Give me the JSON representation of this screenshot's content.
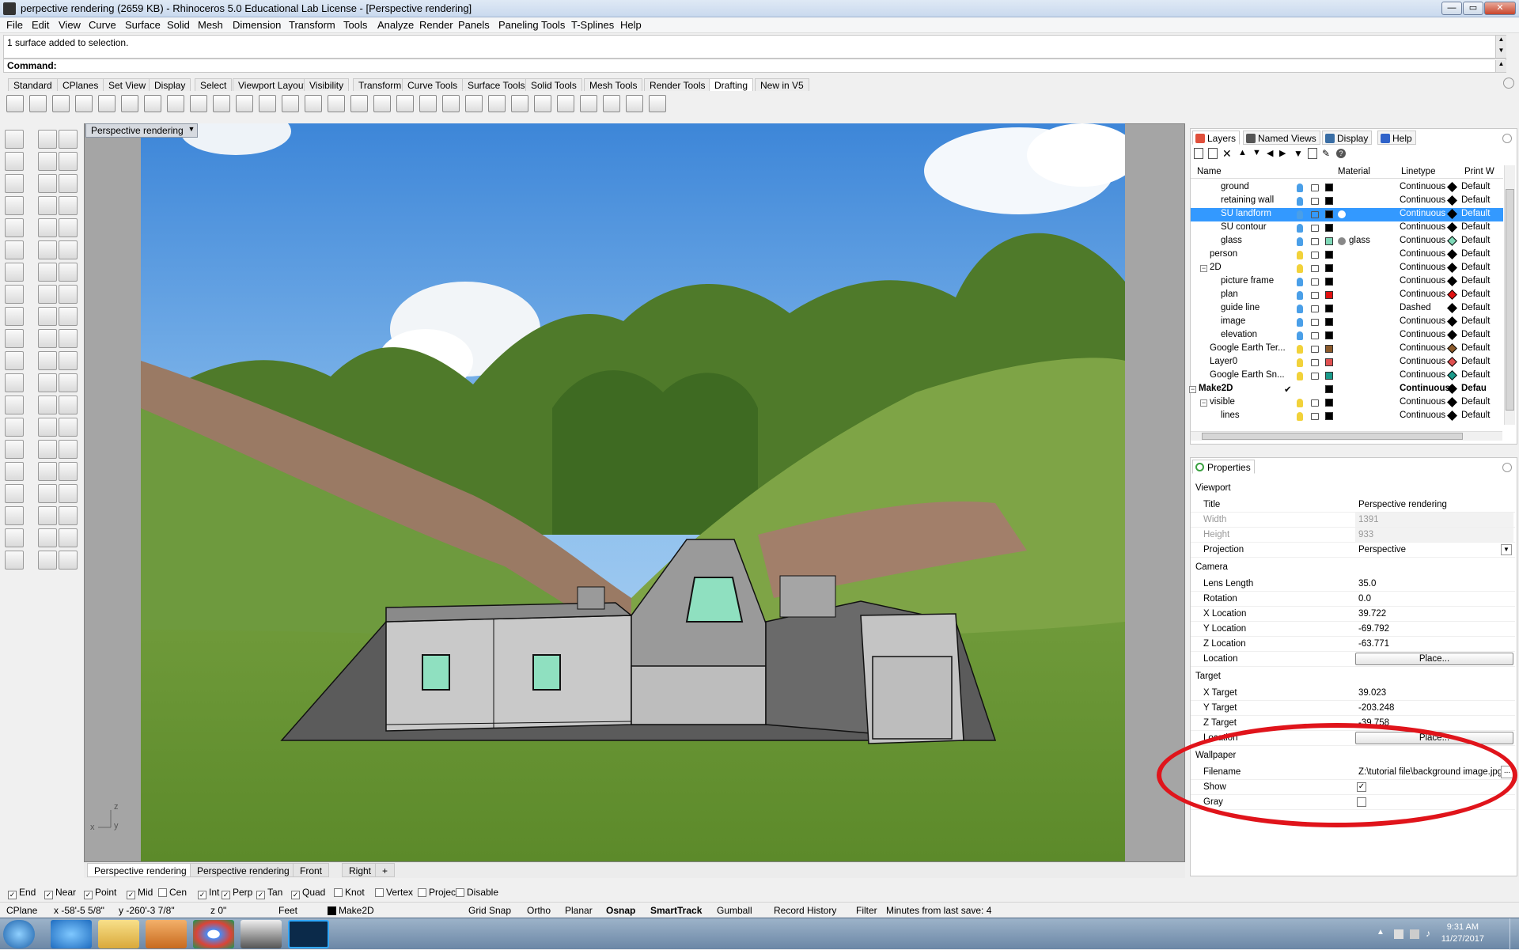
{
  "window": {
    "title": "perpective rendering (2659 KB) - Rhinoceros 5.0 Educational Lab License - [Perspective rendering]",
    "controls": {
      "minimize": "—",
      "maximize": "▭",
      "close": "✕"
    }
  },
  "menu": [
    "File",
    "Edit",
    "View",
    "Curve",
    "Surface",
    "Solid",
    "Mesh",
    "Dimension",
    "Transform",
    "Tools",
    "Analyze",
    "Render",
    "Panels",
    "Paneling Tools",
    "T-Splines",
    "Help"
  ],
  "command": {
    "history": "1 surface added to selection.",
    "prompt": "Command:"
  },
  "toolbar_tabs": [
    "Standard",
    "CPlanes",
    "Set View",
    "Display",
    "Select",
    "Viewport Layout",
    "Visibility",
    "Transform",
    "Curve Tools",
    "Surface Tools",
    "Solid Tools",
    "Mesh Tools",
    "Render Tools",
    "Drafting",
    "New in V5"
  ],
  "toolbar_active_tab": "Drafting",
  "viewport": {
    "title": "Perspective rendering",
    "tabs": [
      "Perspective rendering",
      "Perspective rendering",
      "Front",
      "Right",
      "+"
    ],
    "axis": {
      "z": "z",
      "y": "y",
      "x": "x"
    }
  },
  "layers_panel": {
    "tabs": [
      "Layers",
      "Named Views",
      "Display",
      "Help"
    ],
    "columns": {
      "name": "Name",
      "material": "Material",
      "linetype": "Linetype",
      "print": "Print W"
    },
    "rows": [
      {
        "name": "ground",
        "indent": 2,
        "color": "#000000",
        "material": "",
        "linetype": "Continuous",
        "print": "Default",
        "pcolor": "#000000"
      },
      {
        "name": "retaining wall",
        "indent": 2,
        "color": "#000000",
        "material": "",
        "linetype": "Continuous",
        "print": "Default",
        "pcolor": "#000000"
      },
      {
        "name": "SU landform",
        "indent": 2,
        "color": "#000000",
        "material": "",
        "linetype": "Continuous",
        "print": "Default",
        "pcolor": "#000000",
        "selected": true
      },
      {
        "name": "SU contour",
        "indent": 2,
        "color": "#000000",
        "material": "",
        "linetype": "Continuous",
        "print": "Default",
        "pcolor": "#000000"
      },
      {
        "name": "glass",
        "indent": 2,
        "color": "#7fd9b8",
        "material": "glass",
        "linetype": "Continuous",
        "print": "Default",
        "pcolor": "#7fd9b8"
      },
      {
        "name": "person",
        "indent": 1,
        "color": "#000000",
        "material": "",
        "linetype": "Continuous",
        "print": "Default",
        "pcolor": "#000000"
      },
      {
        "name": "2D",
        "indent": 1,
        "color": "#000000",
        "material": "",
        "linetype": "Continuous",
        "print": "Default",
        "pcolor": "#000000",
        "expander": "−"
      },
      {
        "name": "picture frame",
        "indent": 2,
        "color": "#000000",
        "material": "",
        "linetype": "Continuous",
        "print": "Default",
        "pcolor": "#000000"
      },
      {
        "name": "plan",
        "indent": 2,
        "color": "#e01010",
        "material": "",
        "linetype": "Continuous",
        "print": "Default",
        "pcolor": "#e01010"
      },
      {
        "name": "guide line",
        "indent": 2,
        "color": "#000000",
        "material": "",
        "linetype": "Dashed",
        "print": "Default",
        "pcolor": "#000000"
      },
      {
        "name": "image",
        "indent": 2,
        "color": "#000000",
        "material": "",
        "linetype": "Continuous",
        "print": "Default",
        "pcolor": "#000000"
      },
      {
        "name": "elevation",
        "indent": 2,
        "color": "#000000",
        "material": "",
        "linetype": "Continuous",
        "print": "Default",
        "pcolor": "#000000"
      },
      {
        "name": "Google Earth Ter...",
        "indent": 1,
        "color": "#8b5a2b",
        "material": "",
        "linetype": "Continuous",
        "print": "Default",
        "pcolor": "#8b5a2b"
      },
      {
        "name": "Layer0",
        "indent": 1,
        "color": "#e05050",
        "material": "",
        "linetype": "Continuous",
        "print": "Default",
        "pcolor": "#e05050"
      },
      {
        "name": "Google Earth Sn...",
        "indent": 1,
        "color": "#1a9a8a",
        "material": "",
        "linetype": "Continuous",
        "print": "Default",
        "pcolor": "#1a9a8a"
      },
      {
        "name": "Make2D",
        "indent": 0,
        "color": "#000000",
        "material": "",
        "linetype": "Continuous",
        "print": "Defau",
        "pcolor": "#000000",
        "expander": "−",
        "bold": true,
        "current": "✔"
      },
      {
        "name": "visible",
        "indent": 1,
        "color": "#000000",
        "material": "",
        "linetype": "Continuous",
        "print": "Default",
        "pcolor": "#000000",
        "expander": "−"
      },
      {
        "name": "lines",
        "indent": 2,
        "color": "#000000",
        "material": "",
        "linetype": "Continuous",
        "print": "Default",
        "pcolor": "#000000"
      }
    ]
  },
  "properties": {
    "tab": "Properties",
    "viewport_section": "Viewport",
    "title_label": "Title",
    "title_value": "Perspective rendering",
    "width_label": "Width",
    "width_value": "1391",
    "height_label": "Height",
    "height_value": "933",
    "projection_label": "Projection",
    "projection_value": "Perspective",
    "camera_section": "Camera",
    "lens_label": "Lens Length",
    "lens_value": "35.0",
    "rotation_label": "Rotation",
    "rotation_value": "0.0",
    "xloc_label": "X Location",
    "xloc_value": "39.722",
    "yloc_label": "Y Location",
    "yloc_value": "-69.792",
    "zloc_label": "Z Location",
    "zloc_value": "-63.771",
    "location_label": "Location",
    "place_button": "Place...",
    "target_section": "Target",
    "xt_label": "X Target",
    "xt_value": "39.023",
    "yt_label": "Y Target",
    "yt_value": "-203.248",
    "zt_label": "Z Target",
    "zt_value": "-39.758",
    "tloc_label": "Location",
    "tplace_button": "Place...",
    "wallpaper_section": "Wallpaper",
    "filename_label": "Filename",
    "filename_value": "Z:\\tutorial file\\background image.jpg",
    "browse_button": "...",
    "show_label": "Show",
    "show_checked": true,
    "gray_label": "Gray",
    "gray_checked": false
  },
  "osnap": [
    {
      "label": "End",
      "checked": true
    },
    {
      "label": "Near",
      "checked": true
    },
    {
      "label": "Point",
      "checked": true
    },
    {
      "label": "Mid",
      "checked": true
    },
    {
      "label": "Cen",
      "checked": false
    },
    {
      "label": "Int",
      "checked": true
    },
    {
      "label": "Perp",
      "checked": true
    },
    {
      "label": "Tan",
      "checked": true
    },
    {
      "label": "Quad",
      "checked": true
    },
    {
      "label": "Knot",
      "checked": false
    },
    {
      "label": "Vertex",
      "checked": false
    },
    {
      "label": "Project",
      "checked": false
    },
    {
      "label": "Disable",
      "checked": false
    }
  ],
  "status": {
    "cplane": "CPlane",
    "x": "x -58'-5 5/8\"",
    "y": "y -260'-3 7/8\"",
    "z": "z 0\"",
    "units": "Feet",
    "layer": "Make2D",
    "grid_snap": "Grid Snap",
    "ortho": "Ortho",
    "planar": "Planar",
    "osnap": "Osnap",
    "smarttrack": "SmartTrack",
    "gumball": "Gumball",
    "record_history": "Record History",
    "filter": "Filter",
    "save_info": "Minutes from last save: 4"
  },
  "taskbar": {
    "time": "9:31 AM",
    "date": "11/27/2017"
  }
}
